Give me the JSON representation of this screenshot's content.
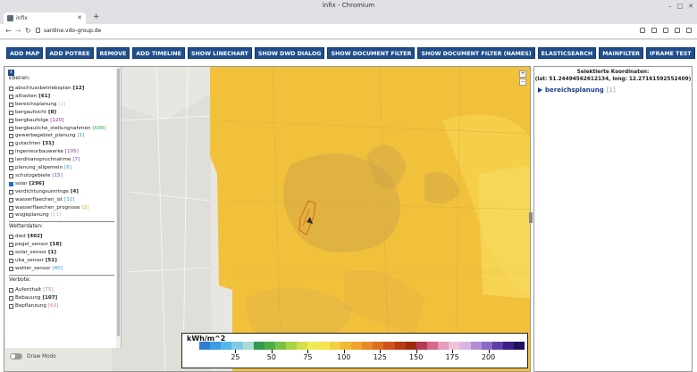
{
  "window": {
    "title": "infix - Chromium"
  },
  "tab": {
    "label": "infix"
  },
  "address": {
    "url": "sardine.vdo-group.de"
  },
  "toolbar": {
    "buttons": [
      "ADD MAP",
      "ADD POTREE",
      "REMOVE",
      "ADD TIMELINE",
      "SHOW LINECHART",
      "SHOW DWD DIALOG",
      "SHOW DOCUMENT FILTER",
      "SHOW DOCUMENT FILTER (NAMES)",
      "ELASTICSEARCH",
      "MAINFILTER",
      "IFRAME TEST"
    ]
  },
  "layers": {
    "close_label": "x",
    "section_ebenen": "Ebenen:",
    "ebenen": [
      {
        "name": "abschlussbetriebsplan",
        "count": "[12]",
        "color": "#222",
        "checked": false
      },
      {
        "name": "altlasten",
        "count": "[61]",
        "color": "#222",
        "checked": false
      },
      {
        "name": "bereichsplanung",
        "count": "[1]",
        "color": "#bbb",
        "checked": false
      },
      {
        "name": "bergaufsicht",
        "count": "[8]",
        "color": "#222",
        "checked": false
      },
      {
        "name": "bergbaufolge",
        "count": "[120]",
        "color": "#a0237a",
        "checked": false
      },
      {
        "name": "bergbauliche_stellungnahmen",
        "count": "[690]",
        "color": "#2aa84a",
        "checked": false
      },
      {
        "name": "gewerbegebiet_planung",
        "count": "[1]",
        "color": "#2a9ad6",
        "checked": false
      },
      {
        "name": "gutachten",
        "count": "[31]",
        "color": "#222",
        "checked": false
      },
      {
        "name": "ingenieurbauwerke",
        "count": "[195]",
        "color": "#7a3fc0",
        "checked": false
      },
      {
        "name": "landinanspruchnahme",
        "count": "[7]",
        "color": "#7a3fc0",
        "checked": false
      },
      {
        "name": "planung_allgemein",
        "count": "[6]",
        "color": "#2a9ad6",
        "checked": false
      },
      {
        "name": "schutzgebiete",
        "count": "[15]",
        "color": "#7a3fc0",
        "checked": false
      },
      {
        "name": "solar",
        "count": "[296]",
        "color": "#222",
        "checked": true
      },
      {
        "name": "verdichtungsumringe",
        "count": "[4]",
        "color": "#222",
        "checked": false
      },
      {
        "name": "wasserflaechen_ist",
        "count": "[32]",
        "color": "#2a9ad6",
        "checked": false
      },
      {
        "name": "wasserflaechen_prognose",
        "count": "[2]",
        "color": "#d8a020",
        "checked": false
      },
      {
        "name": "wogeplanung",
        "count": "[11]",
        "color": "#bbb",
        "checked": false
      }
    ],
    "section_wetter": "Wetterdaten:",
    "wetter": [
      {
        "name": "dwd",
        "count": "[402]",
        "color": "#222",
        "checked": false
      },
      {
        "name": "pegel_sensor",
        "count": "[18]",
        "color": "#222",
        "checked": false
      },
      {
        "name": "solar_sensor",
        "count": "[1]",
        "color": "#222",
        "checked": false
      },
      {
        "name": "uba_sensor",
        "count": "[51]",
        "color": "#222",
        "checked": false
      },
      {
        "name": "wetter_sensor",
        "count": "[40]",
        "color": "#2a9ad6",
        "checked": false
      }
    ],
    "section_verbote": "Verbote:",
    "verbote": [
      {
        "name": "Aufenthalt",
        "count": "[75]",
        "color": "#c07a7a",
        "checked": false
      },
      {
        "name": "Bebauung",
        "count": "[107]",
        "color": "#222",
        "checked": false
      },
      {
        "name": "Bepflanzung",
        "count": "[63]",
        "color": "#c07a7a",
        "checked": false
      }
    ],
    "draw_mode": "Draw Modo"
  },
  "legend": {
    "unit": "kWh/m^2",
    "ticks": [
      "25",
      "50",
      "75",
      "100",
      "125",
      "150",
      "175",
      "200"
    ],
    "colors": [
      "#2f7fd0",
      "#3d9be0",
      "#55b5e6",
      "#7fcbe6",
      "#a8dcd5",
      "#2e9a4e",
      "#4cae45",
      "#7cc243",
      "#a9d246",
      "#cfe04a",
      "#eeea55",
      "#f6e24e",
      "#f2cf3f",
      "#efba34",
      "#eda52c",
      "#e88a25",
      "#df6e1f",
      "#cf5219",
      "#b73b14",
      "#9e2a12",
      "#b53a52",
      "#d46a8c",
      "#e89bbd",
      "#f0c2da",
      "#d8b6e6",
      "#b08fd6",
      "#8a6ac4",
      "#5d3fa8",
      "#3a1f85",
      "#1f0f5e"
    ]
  },
  "coords": {
    "title": "Selektierte Koordinaten:",
    "value": "(lat: 51.24494562612134, long: 12.27161592552409)"
  },
  "tree": {
    "label": "bereichsplanung",
    "count": "[1]"
  }
}
